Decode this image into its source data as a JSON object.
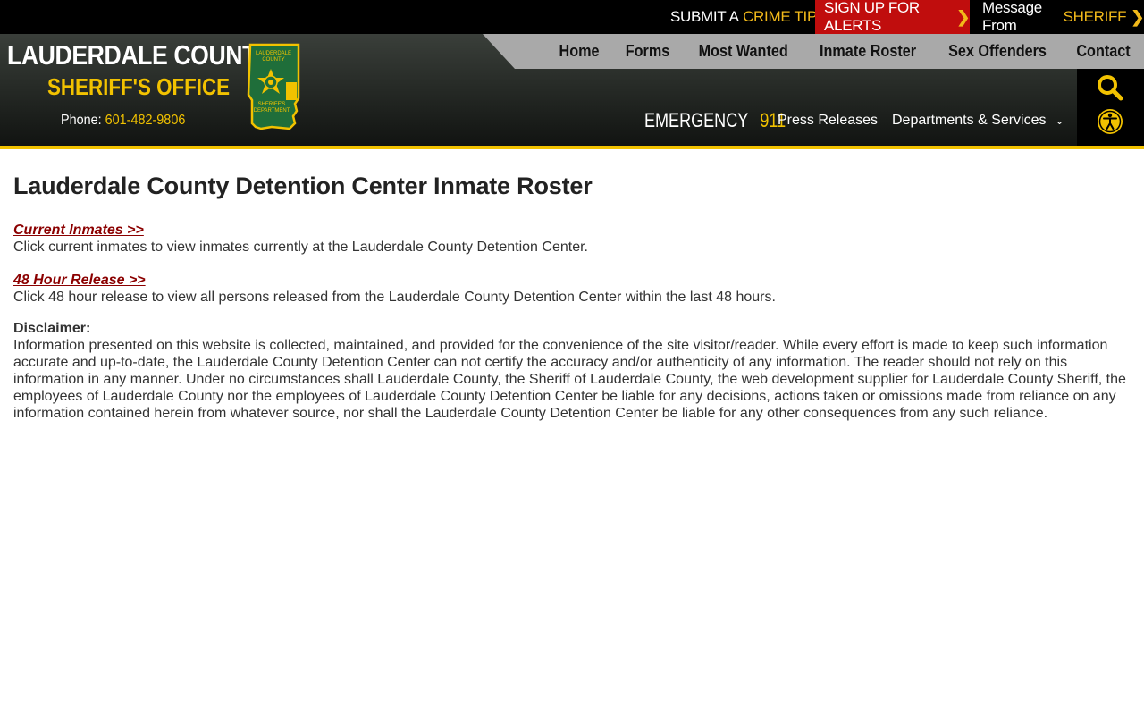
{
  "topbar": {
    "crime_tip_prefix": "SUBMIT A",
    "crime_tip_accent": "CRIME TIP",
    "alerts_label": "SIGN UP FOR ALERTS",
    "sheriff_prefix": "Message From",
    "sheriff_accent": "SHERIFF"
  },
  "brand": {
    "line1": "LAUDERDALE COUNTY",
    "line2": "SHERIFF'S OFFICE",
    "phone_label": "Phone:",
    "phone_number": "601-482-9806",
    "seal_top_text": "LAUDERDALE COUNTY",
    "seal_bottom_text": "SHERIFF'S DEPARTMENT"
  },
  "nav": {
    "items": [
      {
        "label": "Home"
      },
      {
        "label": "Forms"
      },
      {
        "label": "Most Wanted"
      },
      {
        "label": "Inmate Roster"
      },
      {
        "label": "Sex Offenders"
      },
      {
        "label": "Contact"
      }
    ],
    "emergency_label": "EMERGENCY",
    "emergency_number": "911",
    "press_releases": "Press Releases",
    "departments": "Departments & Services"
  },
  "icons": {
    "search": "search-icon",
    "accessibility": "accessibility-icon",
    "chevron": "chevron-right-icon"
  },
  "colors": {
    "accent_yellow": "#f2c200",
    "alert_red": "#c00d0d",
    "link_red": "#8b0000",
    "header_dark": "#252925"
  },
  "main": {
    "title": "Lauderdale County Detention Center Inmate Roster",
    "current_inmates_link": "Current Inmates >>",
    "current_inmates_desc": "Click current inmates to view inmates currently at the Lauderdale County Detention Center.",
    "release_link": "48 Hour Release >>",
    "release_desc": "Click 48 hour release to view all persons released from the Lauderdale County Detention Center within the last 48 hours.",
    "disclaimer_label": "Disclaimer:",
    "disclaimer_text": "Information presented on this website is collected, maintained, and provided for the convenience of the site visitor/reader. While every effort is made to keep such information accurate and up-to-date, the Lauderdale County Detention Center can not certify the accuracy and/or authenticity of any information. The reader should not rely on this information in any manner.  Under no circumstances shall Lauderdale County, the Sheriff of Lauderdale County, the web development supplier for Lauderdale County Sheriff, the employees of Lauderdale County nor the employees of Lauderdale County Detention Center be liable for any decisions, actions taken or omissions made from reliance on any information contained herein from whatever source, nor shall the Lauderdale County Detention Center be liable for any other consequences from any such reliance."
  }
}
